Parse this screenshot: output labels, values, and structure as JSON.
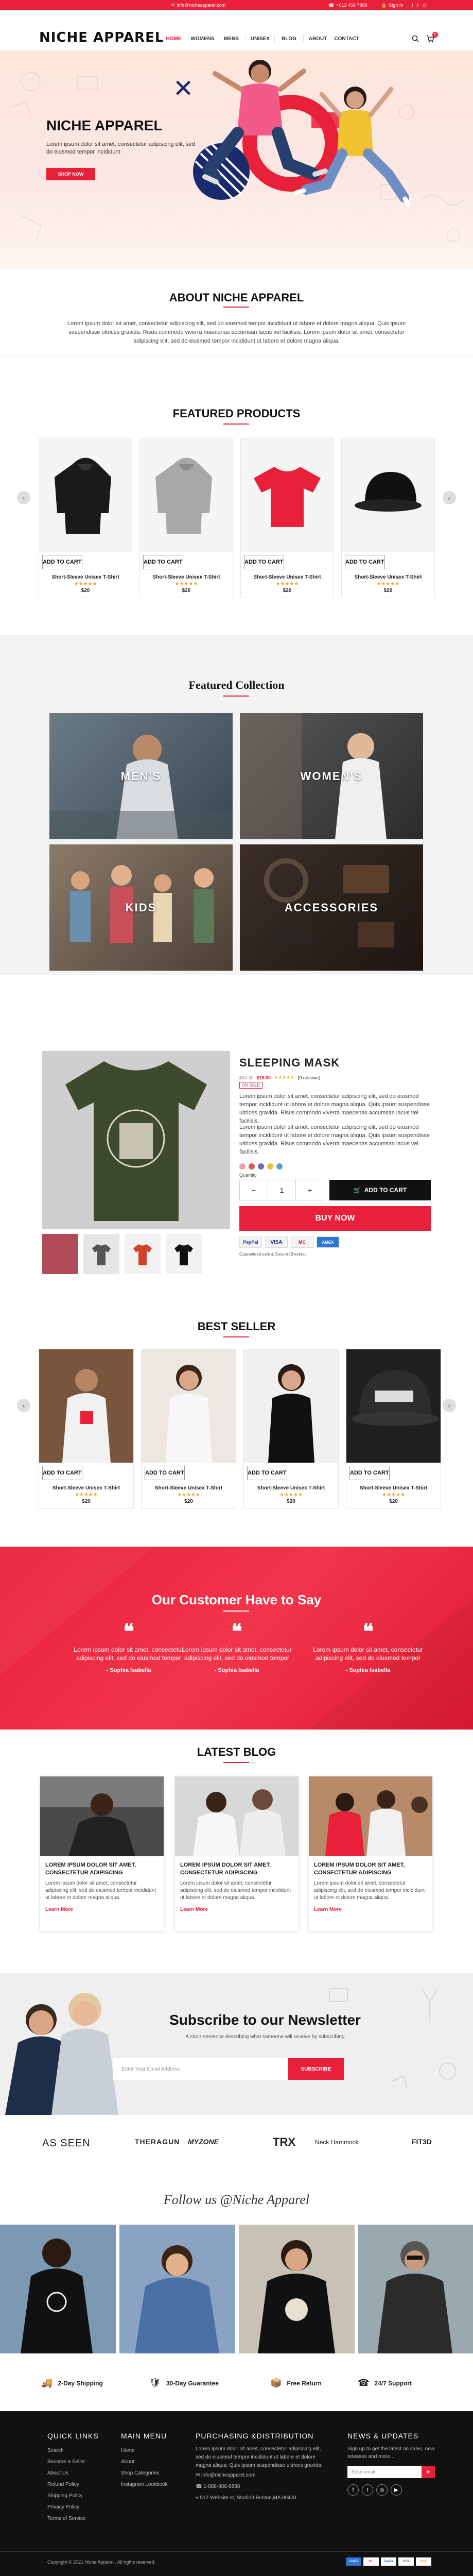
{
  "topbar": {
    "email": "info@nicheapparel.com",
    "phone": "+012 456 7890",
    "signin": "Sign In"
  },
  "header": {
    "logo": "NICHE APPAREL",
    "nav": [
      "HOME",
      "WOMENS",
      "MENS",
      "UNISEX",
      "BLOG",
      "ABOUT",
      "CONTACT"
    ],
    "cart_count": "0"
  },
  "hero": {
    "title": "NICHE APPAREL",
    "text": "Lorem ipsum dolor sit amet, consectetur adipiscing elit, sed do eiusmod tempor incididunt",
    "button": "SHOP NOW"
  },
  "about": {
    "title": "ABOUT NICHE APPAREL",
    "text": "Lorem ipsum dolor sit amet, consectetur adipiscing elit, sed do eiusmod tempor incididunt ut labore et dolore magna aliqua. Quis ipsum suspendisse ultrices gravida. Risus commodo viverra maecenas accumsan lacus vel facilisis. Lorem ipsum dolor sit amet, consectetur adipiscing elit, sed do eiusmod tempor incididunt ut labore et dolore magna aliqua."
  },
  "featured_products": {
    "title": "FEATURED PRODUCTS",
    "items": [
      {
        "name": "Short-Sleeve Unisex T-Shirt",
        "price": "$20",
        "cart": "ADD TO CART",
        "stars": "★★★★★"
      },
      {
        "name": "Short-Sleeve Unisex T-Shirt",
        "price": "$20",
        "cart": "ADD TO CART",
        "stars": "★★★★★"
      },
      {
        "name": "Short-Sleeve Unisex T-Shirt",
        "price": "$20",
        "cart": "ADD TO CART",
        "stars": "★★★★★"
      },
      {
        "name": "Short-Sleeve Unisex T-Shirt",
        "price": "$20",
        "cart": "ADD TO CART",
        "stars": "★★★★★"
      }
    ]
  },
  "collection": {
    "title": "Featured Collection",
    "tiles": [
      "MEN'S",
      "WOMEN'S",
      "KIDS",
      "ACCESSORIES"
    ]
  },
  "product_detail": {
    "title": "SLEEPING MASK",
    "old_price": "$30.00",
    "price": "$18.00",
    "reviews": "(0 reviews)",
    "sale": "ON SALE",
    "desc1": "Lorem ipsum dolor sit amet, consectetur adipiscing elit, sed do eiusmod tempor incididunt ut labore et dolore magna aliqua. Quis ipsum suspendisse ultrices gravida. Risus commodo viverra maecenas accumsan lacus vel facilisis.",
    "desc2": "Lorem ipsum dolor sit amet, consectetur adipiscing elit, sed do eiusmod tempor incididunt ut labore et dolore magna aliqua. Quis ipsum suspendisse ultrices gravida. Risus commodo viverra maecenas accumsan lacus vel facilisis.",
    "quantity_label": "Quantity",
    "qty": "1",
    "add_to_cart": "ADD TO CART",
    "buy_now": "BUY NOW",
    "guarantee": "Guaranteed safe & Secure Checkout",
    "payments": [
      "PayPal",
      "VISA",
      "MC",
      "AMEX"
    ]
  },
  "best_seller": {
    "title": "BEST SELLER",
    "items": [
      {
        "name": "Short-Sleeve Unisex T-Shirt",
        "price": "$20",
        "cart": "ADD TO CART",
        "stars": "★★★★★"
      },
      {
        "name": "Short-Sleeve Unisex T-Shirt",
        "price": "$20",
        "cart": "ADD TO CART",
        "stars": "★★★★★"
      },
      {
        "name": "Short-Sleeve Unisex T-Shirt",
        "price": "$20",
        "cart": "ADD TO CART",
        "stars": "★★★★★"
      },
      {
        "name": "Short-Sleeve Unisex T-Shirt",
        "price": "$20",
        "cart": "ADD TO CART",
        "stars": "★★★★★"
      }
    ]
  },
  "testimonials": {
    "title": "Our Customer Have to Say",
    "items": [
      {
        "text": "Lorem ipsum dolor sit amet, consectetur adipiscing elit, sed do eiusmod tempor",
        "author": "- Sophia Isabella"
      },
      {
        "text": "Lorem ipsum dolor sit amet, consectetur adipiscing elit, sed do eiusmod tempor",
        "author": "- Sophia Isabella"
      },
      {
        "text": "Lorem ipsum dolor sit amet, consectetur adipiscing elit, sed do eiusmod tempor",
        "author": "- Sophia Isabella"
      }
    ]
  },
  "blog": {
    "title": "LATEST BLOG",
    "items": [
      {
        "title": "LOREM IPSUM DOLOR SIT AMET, CONSECTETUR ADIPISCING",
        "text": "Lorem ipsum dolor sit amet, consectetur adipiscing elit, sed do eiusmod tempor incididunt ut labore et dolore magna aliqua.",
        "more": "Learn More"
      },
      {
        "title": "LOREM IPSUM DOLOR SIT AMET, CONSECTETUR ADIPISCING",
        "text": "Lorem ipsum dolor sit amet, consectetur adipiscing elit, sed do eiusmod tempor incididunt ut labore et dolore magna aliqua.",
        "more": "Learn More"
      },
      {
        "title": "LOREM IPSUM DOLOR SIT AMET, CONSECTETUR ADIPISCING",
        "text": "Lorem ipsum dolor sit amet, consectetur adipiscing elit, sed do eiusmod tempor incididunt ut labore et dolore magna aliqua.",
        "more": "Learn More"
      }
    ]
  },
  "newsletter": {
    "title": "Subscribe to our Newsletter",
    "subtitle": "A short sentence describing what someone will receive by subscribing",
    "placeholder": "Enter Your Email Address",
    "button": "SUBSCRIBE"
  },
  "as_seen": {
    "label": "AS SEEN",
    "brands": [
      "THERAGUN",
      "MYZONE",
      "TRX",
      "Neck Hammock",
      "FIT3D"
    ]
  },
  "follow": {
    "title": "Follow us @Niche Apparel"
  },
  "features": [
    "2-Day Shipping",
    "30-Day Guarantee",
    "Free Return",
    "24/7 Support"
  ],
  "footer": {
    "quick_links": {
      "title": "QUICK LINKS",
      "items": [
        "Search",
        "Become a Seller",
        "About Us",
        "Refund Policy",
        "Shipping Policy",
        "Privacy Policy",
        "Terms of Service"
      ]
    },
    "main_menu": {
      "title": "MAIN MENU",
      "items": [
        "Home",
        "About",
        "Shop Categories",
        "Instagram Lookbook"
      ]
    },
    "purchasing": {
      "title": "PURCHASING &DISTRIBUTION",
      "text": "Lorem ipsum dolor sit amet, consectetur adipiscing elit, sed do eiusmod tempor incididunt ut labore et dolore magna aliqua. Quis ipsum suspendisse ultrices gravida.",
      "email": "info@nicheapparel.com",
      "phone": "1-888-888-8888",
      "address": "512 Website st, Studio3 Boston,MA 00400"
    },
    "news": {
      "title": "NEWS & UPDATES",
      "text": "Sign up to get the latest on sales, new releases and more...",
      "placeholder": "Enter email"
    },
    "copyright": "Copyright © 2021 Niche Apparel . All rights reserved.",
    "payments": [
      "AMEX",
      "MC",
      "PayPal",
      "VISA",
      "DISC"
    ]
  }
}
